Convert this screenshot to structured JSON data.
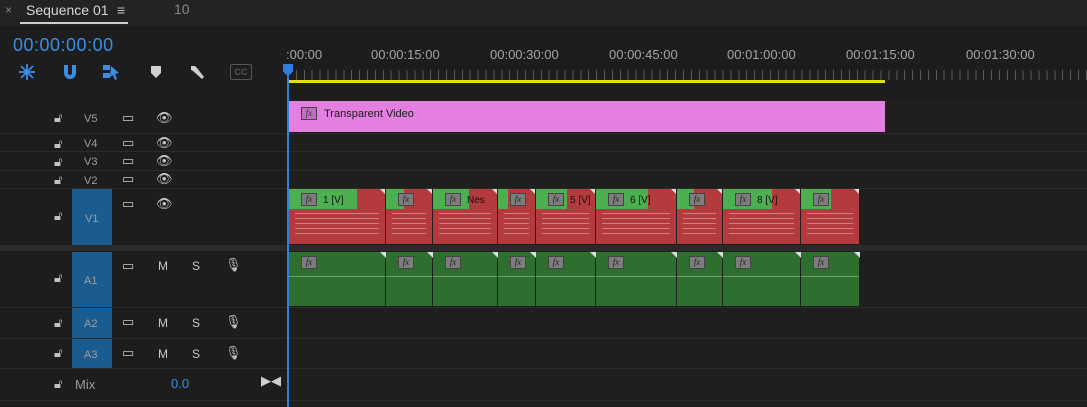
{
  "tab": {
    "close": "×",
    "title": "Sequence 01",
    "menu": "≡",
    "next": "10"
  },
  "timecode": "00:00:00:00",
  "tools": [
    "snap-icon",
    "magnet-icon",
    "linked-selection-icon",
    "marker-icon",
    "wrench-icon",
    "captions-icon"
  ],
  "tools_labels": {
    "cc": "CC"
  },
  "ruler": {
    "labels": [
      ":00:00",
      "00:00:15:00",
      "00:00:30:00",
      "00:00:45:00",
      "00:01:00:00",
      "00:01:15:00",
      "00:01:30:00"
    ]
  },
  "tracks": {
    "video": [
      {
        "name": "V5"
      },
      {
        "name": "V4"
      },
      {
        "name": "V3"
      },
      {
        "name": "V2"
      },
      {
        "name": "V1"
      }
    ],
    "audio": [
      {
        "name": "A1",
        "m": "M",
        "s": "S"
      },
      {
        "name": "A2",
        "m": "M",
        "s": "S"
      },
      {
        "name": "A3",
        "m": "M",
        "s": "S"
      }
    ],
    "mix": {
      "label": "Mix",
      "value": "0.0"
    }
  },
  "clips": {
    "v5": {
      "fx": "fx",
      "label": "Transparent Video",
      "color": "#e27fe1"
    },
    "v1": [
      {
        "fx": "fx",
        "label": "1 [V]"
      },
      {
        "fx": "fx",
        "label": ""
      },
      {
        "fx": "fx",
        "label": "Nes"
      },
      {
        "fx": "fx",
        "label": ""
      },
      {
        "fx": "fx",
        "label": "5 [V]"
      },
      {
        "fx": "fx",
        "label": "6 [V]"
      },
      {
        "fx": "fx",
        "label": ""
      },
      {
        "fx": "fx",
        "label": "8 [V]"
      },
      {
        "fx": "fx",
        "label": ""
      }
    ],
    "a1": [
      "fx",
      "fx",
      "fx",
      "fx",
      "fx",
      "fx",
      "fx",
      "fx",
      "fx"
    ]
  },
  "colors": {
    "accent": "#3b8de8",
    "video_clip": "#4cb050",
    "video_thumb": "#b33a3d",
    "audio_clip": "#2e6e2e",
    "workarea": "#e3df18"
  }
}
